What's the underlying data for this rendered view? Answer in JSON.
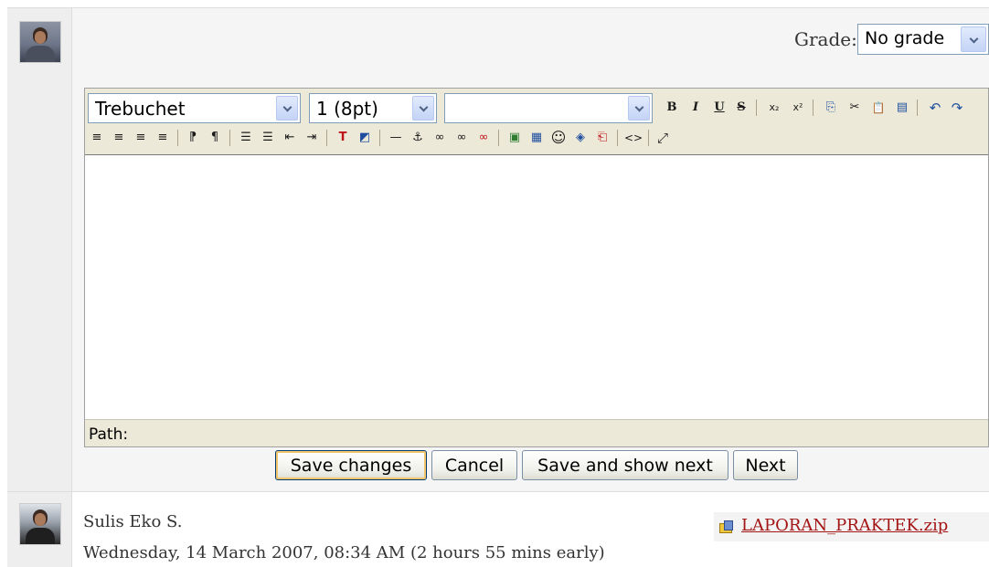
{
  "grading": {
    "grade_label": "Grade:",
    "grade_value": "No grade"
  },
  "editor": {
    "font_value": "Trebuchet",
    "size_value": "1 (8pt)",
    "style_value": "",
    "path_label": "Path:",
    "toolbar_row1": {
      "bold": "B",
      "italic": "I",
      "underline": "U",
      "strike": "S",
      "subscript": "x₂",
      "superscript": "x²",
      "copy": "⎘",
      "cut": "✂",
      "paste": "📋",
      "paste_word": "▤",
      "undo": "↶",
      "redo": "↷"
    },
    "toolbar_row2": {
      "align_left": "≡",
      "align_center": "≡",
      "align_right": "≡",
      "justify": "≡",
      "ltr": "⁋",
      "rtl": "¶",
      "ordered_list": "☰",
      "unordered_list": "☰",
      "outdent": "⇤",
      "indent": "⇥",
      "text_color": "T",
      "bg_color": "◩",
      "hr": "—",
      "anchor": "⚓",
      "link": "∞",
      "unlink": "∞",
      "nolink": "∞",
      "image": "▣",
      "table": "▦",
      "smiley": "☺",
      "special_char": "◈",
      "search_replace": "⎗",
      "html_source": "<>",
      "fullscreen": "⤢"
    }
  },
  "buttons": {
    "save": "Save changes",
    "cancel": "Cancel",
    "save_next": "Save and show next",
    "next": "Next"
  },
  "submission": {
    "student_name": "Sulis Eko S.",
    "time": "Wednesday, 14 March 2007, 08:34 AM (2 hours 55 mins early)",
    "file_name": "LAPORAN_PRAKTEK.zip"
  }
}
